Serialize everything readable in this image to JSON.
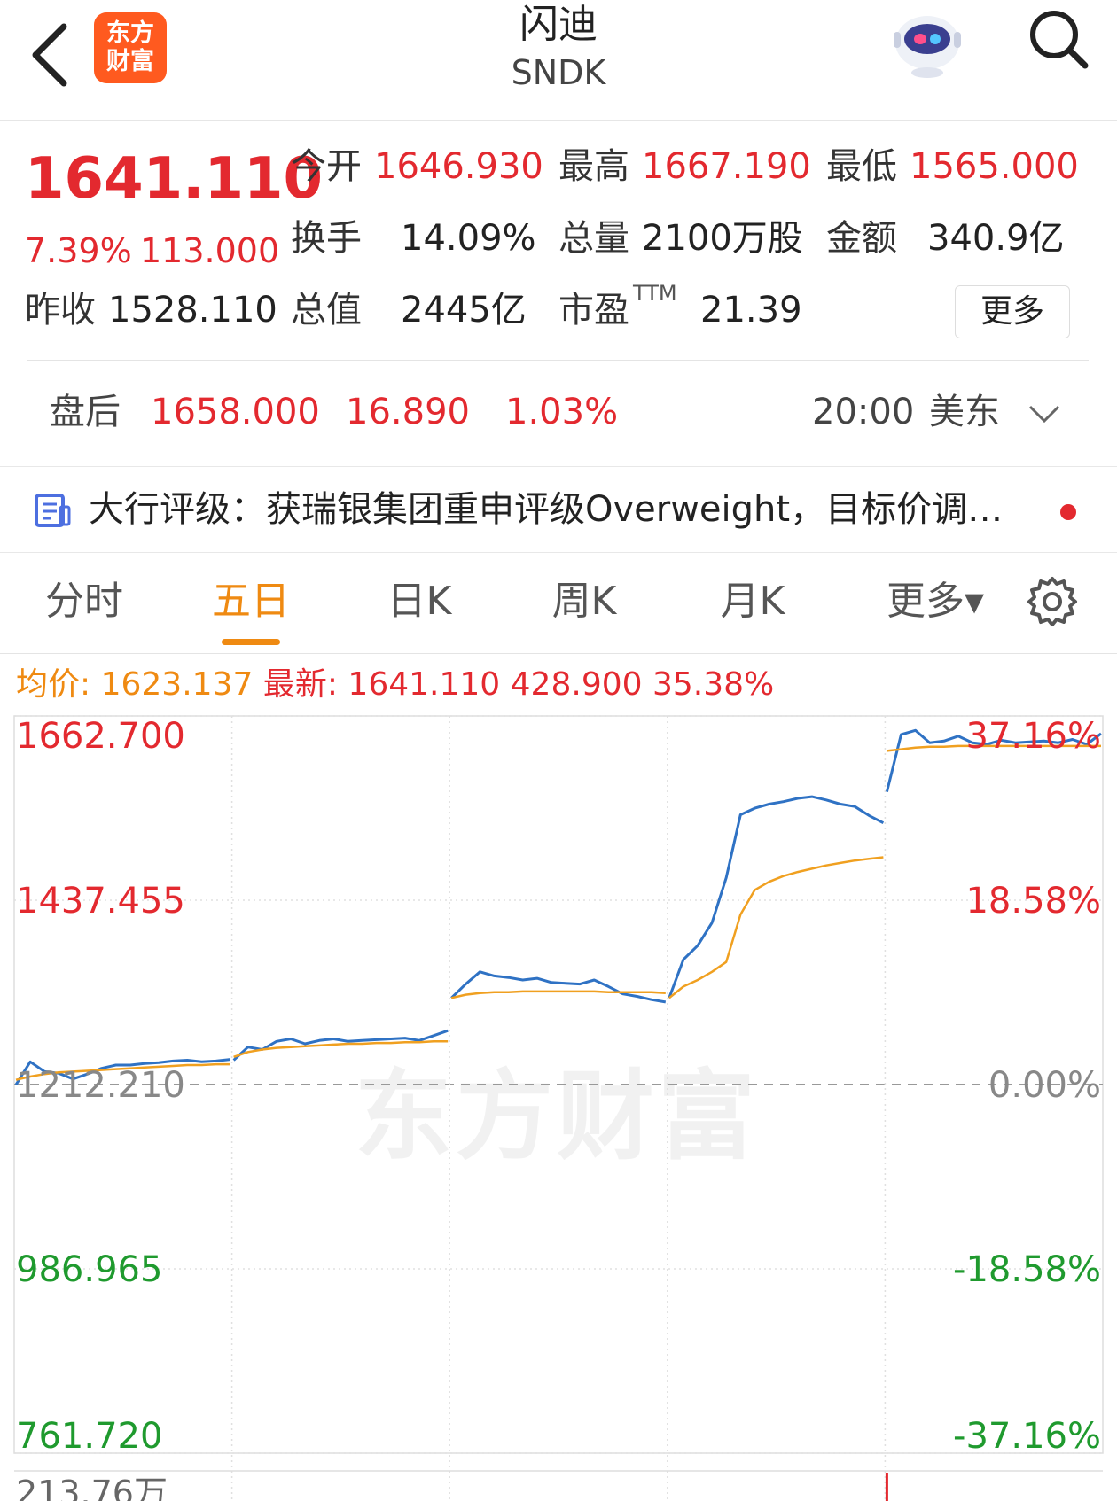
{
  "header": {
    "back_icon": "chevron-left-icon",
    "logo_line1": "东方",
    "logo_line2": "财富",
    "title": "闪迪",
    "ticker": "SNDK",
    "assistant_icon": "robot-icon",
    "search_icon": "search-icon"
  },
  "quote": {
    "price": "1641.110",
    "change_pct": "7.39%",
    "change_abs": "113.000",
    "prev_close_label": "昨收",
    "prev_close": "1528.110",
    "open_label": "今开",
    "open": "1646.930",
    "high_label": "最高",
    "high": "1667.190",
    "low_label": "最低",
    "low": "1565.000",
    "turnover_label": "换手",
    "turnover": "14.09%",
    "volume_label": "总量",
    "volume": "2100万股",
    "amount_label": "金额",
    "amount": "340.9亿",
    "mktcap_label": "总值",
    "mktcap": "2445亿",
    "pe_label": "市盈",
    "pe_sup": "TTM",
    "pe": "21.39",
    "more_button": "更多"
  },
  "after_hours": {
    "label": "盘后",
    "price": "1658.000",
    "change": "16.890",
    "pct": "1.03%",
    "time": "20:00",
    "zone": "美东",
    "expand_icon": "chevron-down-icon"
  },
  "news": {
    "icon": "document-icon",
    "text": "大行评级：获瑞银集团重申评级Overweight，目标价调…"
  },
  "tabs": [
    {
      "label": "分时"
    },
    {
      "label": "五日"
    },
    {
      "label": "日K"
    },
    {
      "label": "周K"
    },
    {
      "label": "月K"
    },
    {
      "label": "更多▾"
    }
  ],
  "active_tab": "五日",
  "settings_icon": "gear-icon",
  "chart_info": {
    "avg_label": "均价:",
    "avg_value": "1623.137",
    "latest_label": "最新:",
    "latest_value": "1641.110",
    "latest_change": "428.900",
    "latest_pct": "35.38%"
  },
  "watermark": "东方财富",
  "colors": {
    "up": "#e3292f",
    "down": "#1f9a2e",
    "accent": "#ef8a12",
    "price_line": "#2f72c4",
    "avg_line": "#f0a020"
  },
  "chart_data": {
    "type": "line",
    "title": "",
    "xlabel": "",
    "ylabel": "",
    "ylim": [
      761.72,
      1662.7
    ],
    "base": 1212.21,
    "y_ticks_left": [
      "1662.700",
      "1437.455",
      "1212.210",
      "986.965",
      "761.720"
    ],
    "y_ticks_right": [
      "37.16%",
      "18.58%",
      "0.00%",
      "-18.58%",
      "-37.16%"
    ],
    "volume_label": "213.76万",
    "days": 5,
    "series": [
      {
        "id": "price",
        "values": [
          [
            1212,
            1240,
            1228,
            1226,
            1219,
            1225,
            1232,
            1236,
            1236,
            1238,
            1239,
            1241,
            1242,
            1240,
            1241,
            1243
          ],
          [
            1242,
            1258,
            1255,
            1265,
            1268,
            1262,
            1266,
            1268,
            1265,
            1266,
            1267,
            1268,
            1269,
            1266,
            1272,
            1278
          ],
          [
            1318,
            1335,
            1350,
            1345,
            1343,
            1340,
            1342,
            1337,
            1336,
            1335,
            1340,
            1332,
            1323,
            1320,
            1316,
            1313
          ],
          [
            1318,
            1365,
            1382,
            1410,
            1465,
            1542,
            1550,
            1555,
            1558,
            1562,
            1564,
            1560,
            1555,
            1552,
            1541,
            1532
          ],
          [
            1570,
            1640,
            1645,
            1630,
            1632,
            1638,
            1630,
            1628,
            1633,
            1630,
            1631,
            1632,
            1630,
            1634,
            1628,
            1641.11
          ]
        ]
      },
      {
        "id": "avg",
        "values": [
          [
            1218,
            1222,
            1225,
            1227,
            1228,
            1229,
            1230,
            1231,
            1232,
            1233,
            1234,
            1235,
            1236,
            1236,
            1237,
            1237
          ],
          [
            1246,
            1252,
            1255,
            1257,
            1258,
            1259,
            1260,
            1261,
            1262,
            1262,
            1263,
            1263,
            1264,
            1264,
            1265,
            1265
          ],
          [
            1318,
            1322,
            1324,
            1325,
            1325,
            1326,
            1326,
            1326,
            1326,
            1326,
            1326,
            1325,
            1325,
            1325,
            1325,
            1324
          ],
          [
            1318,
            1332,
            1340,
            1350,
            1362,
            1420,
            1450,
            1460,
            1467,
            1472,
            1476,
            1480,
            1483,
            1486,
            1488,
            1490
          ],
          [
            1620,
            1622,
            1624,
            1625,
            1625,
            1626,
            1626,
            1626,
            1626,
            1626,
            1626,
            1626,
            1626,
            1626,
            1626,
            1626
          ]
        ]
      }
    ]
  }
}
